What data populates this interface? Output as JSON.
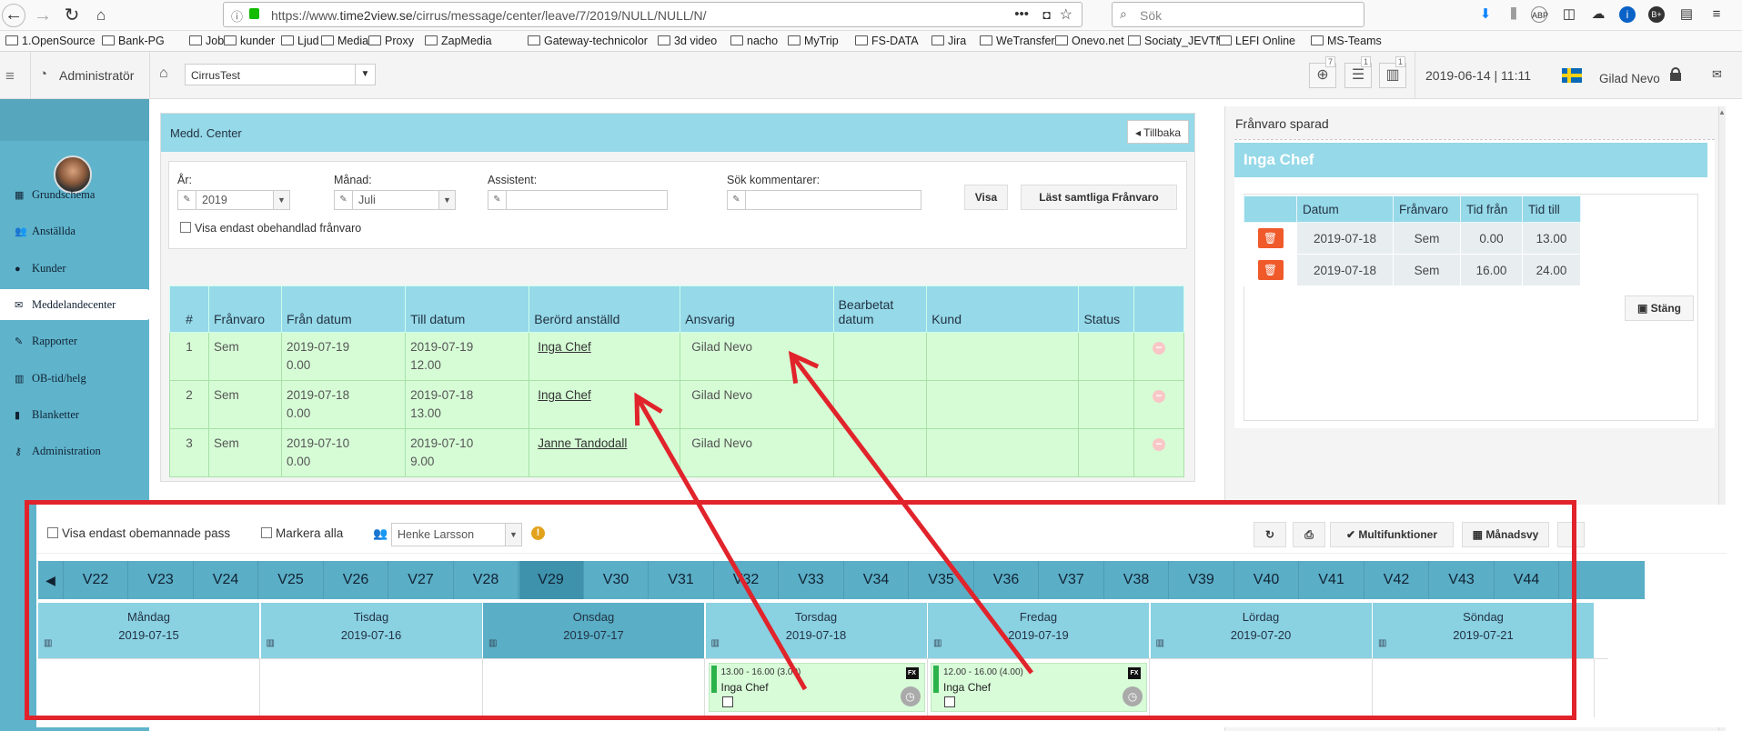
{
  "browser": {
    "url_prefix": "https://www.",
    "url_domain": "time2view.se",
    "url_path": "/cirrus/message/center/leave/7/2019/NULL/NULL/N/",
    "search_placeholder": "Sök",
    "bookmarks": [
      "1.OpenSource",
      "Bank-PG",
      "Jobb",
      "kunder",
      "Ljud",
      "Media",
      "Proxy",
      "ZapMedia",
      "Gateway-technicolor",
      "3d video",
      "nacho",
      "MyTrip",
      "FS-DATA",
      "Jira",
      "WeTransfer",
      "Onevo.net",
      "Sociaty_JEVTM",
      "LEFI Online",
      "MS-Teams"
    ]
  },
  "header": {
    "role": "Administratör",
    "site": "CirrusTest",
    "icon_counts": [
      "7",
      "1",
      "1"
    ],
    "datetime": "2019-06-14 | 11:11",
    "user": "Gilad Nevo"
  },
  "sidebar": {
    "items": [
      {
        "label": "Grundschema",
        "icon": "calendar-icon"
      },
      {
        "label": "Anställda",
        "icon": "users-icon"
      },
      {
        "label": "Kunder",
        "icon": "user-icon"
      },
      {
        "label": "Meddelandecenter",
        "icon": "envelope-icon"
      },
      {
        "label": "Rapporter",
        "icon": "pencil-icon"
      },
      {
        "label": "OB-tid/helg",
        "icon": "chart-icon"
      },
      {
        "label": "Blanketter",
        "icon": "book-icon"
      },
      {
        "label": "Administration",
        "icon": "key-icon"
      }
    ],
    "active_index": 3
  },
  "messageCenter": {
    "title": "Medd. Center",
    "back_label": "Tillbaka",
    "filters": {
      "year_label": "År:",
      "year_value": "2019",
      "month_label": "Månad:",
      "month_value": "Juli",
      "assistant_label": "Assistent:",
      "assistant_value": "",
      "search_label": "Sök kommentarer:",
      "search_value": "",
      "show_label": "Visa",
      "read_all_label": "Läst samtliga Frånvaro",
      "only_unhandled_label": "Visa endast obehandlad frånvaro"
    },
    "table": {
      "headers": [
        "#",
        "Frånvaro",
        "Från datum",
        "Till datum",
        "Berörd anställd",
        "Ansvarig",
        "Bearbetat datum",
        "Kund",
        "Status",
        ""
      ],
      "rows": [
        {
          "num": "1",
          "type": "Sem",
          "from_date": "2019-07-19",
          "from_time": "0.00",
          "to_date": "2019-07-19",
          "to_time": "12.00",
          "employee": "Inga Chef",
          "responsible": "Gilad Nevo",
          "processed": "",
          "customer": "",
          "status": ""
        },
        {
          "num": "2",
          "type": "Sem",
          "from_date": "2019-07-18",
          "from_time": "0.00",
          "to_date": "2019-07-18",
          "to_time": "13.00",
          "employee": "Inga Chef",
          "responsible": "Gilad Nevo",
          "processed": "",
          "customer": "",
          "status": ""
        },
        {
          "num": "3",
          "type": "Sem",
          "from_date": "2019-07-10",
          "from_time": "0.00",
          "to_date": "2019-07-10",
          "to_time": "9.00",
          "employee": "Janne Tandodall",
          "responsible": "Gilad Nevo",
          "processed": "",
          "customer": "",
          "status": ""
        }
      ]
    }
  },
  "absencePanel": {
    "title": "Frånvaro sparad",
    "employee": "Inga Chef",
    "headers": [
      "",
      "Datum",
      "Frånvaro",
      "Tid från",
      "Tid till"
    ],
    "rows": [
      {
        "date": "2019-07-18",
        "type": "Sem",
        "from": "0.00",
        "to": "13.00"
      },
      {
        "date": "2019-07-18",
        "type": "Sem",
        "from": "16.00",
        "to": "24.00"
      }
    ],
    "close_label": "Stäng"
  },
  "scheduler": {
    "only_unmanned_label": "Visa endast obemannade pass",
    "select_all_label": "Markera alla",
    "person": "Henke Larsson",
    "multi_label": "Multifunktioner",
    "month_view_label": "Månadsvy",
    "weeks": [
      "V22",
      "V23",
      "V24",
      "V25",
      "V26",
      "V27",
      "V28",
      "V29",
      "V30",
      "V31",
      "V32",
      "V33",
      "V34",
      "V35",
      "V36",
      "V37",
      "V38",
      "V39",
      "V40",
      "V41",
      "V42",
      "V43",
      "V44"
    ],
    "selected_week": "V29",
    "days": [
      {
        "name": "Måndag",
        "date": "2019-07-15"
      },
      {
        "name": "Tisdag",
        "date": "2019-07-16"
      },
      {
        "name": "Onsdag",
        "date": "2019-07-17",
        "selected": true
      },
      {
        "name": "Torsdag",
        "date": "2019-07-18"
      },
      {
        "name": "Fredag",
        "date": "2019-07-19"
      },
      {
        "name": "Lördag",
        "date": "2019-07-20"
      },
      {
        "name": "Söndag",
        "date": "2019-07-21"
      }
    ],
    "shifts": [
      {
        "day_index": 3,
        "time": "13.00 - 16.00 (3.00)",
        "name": "Inga Chef",
        "badge": "FX"
      },
      {
        "day_index": 4,
        "time": "12.00 - 16.00 (4.00)",
        "name": "Inga Chef",
        "badge": "FX"
      }
    ]
  },
  "annotation_color": "#e1232b"
}
